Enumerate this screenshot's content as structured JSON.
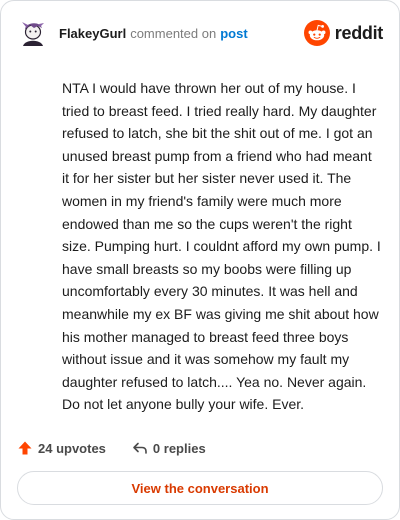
{
  "header": {
    "username": "FlakeyGurl",
    "action_text": "commented on",
    "target_link": "post",
    "brand_name": "reddit"
  },
  "comment": {
    "text": "NTA I would have thrown her out of my house. I tried to breast feed. I tried really hard. My daughter refused to latch, she bit the shit out of me. I got an unused breast pump from a friend who had meant it for her sister but her sister never used it. The women in my friend's family were much more endowed than me so the cups weren't the right size. Pumping hurt. I couldnt afford my own pump. I have small breasts so my boobs were filling up uncomfortably every 30 minutes. It was hell and meanwhile my ex BF was giving me shit about how his mother managed to breast feed three boys without issue and it was somehow my fault my daughter refused to latch.... Yea no. Never again. Do not let anyone bully your wife. Ever."
  },
  "footer": {
    "upvotes_label": "24 upvotes",
    "replies_label": "0 replies"
  },
  "actions": {
    "view_conversation_label": "View the conversation"
  },
  "colors": {
    "brand_orange": "#ff4500",
    "link_blue": "#0079d3",
    "button_text": "#d93a00"
  },
  "icons": {
    "avatar": "avatar-icon",
    "brand": "reddit-alien-icon",
    "upvote": "upvote-arrow-icon",
    "reply": "reply-arrow-icon"
  }
}
